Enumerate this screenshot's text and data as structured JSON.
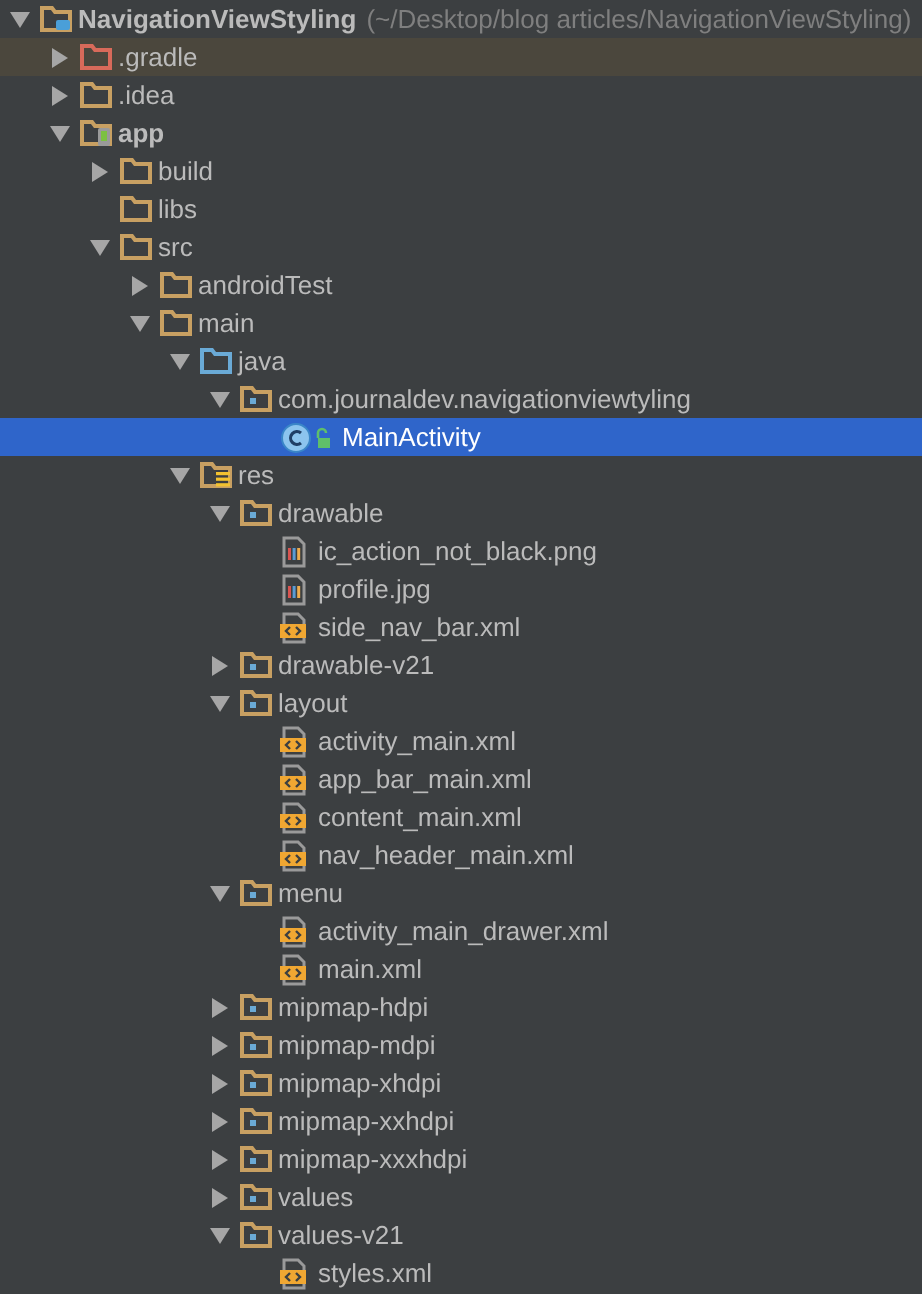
{
  "project": {
    "name": "NavigationViewStyling",
    "location": "(~/Desktop/blog articles/NavigationViewStyling)",
    "kind": "project",
    "expanded": true,
    "selected": false,
    "children": [
      {
        "name": ".gradle",
        "kind": "folder_excluded",
        "expanded": false,
        "selected": false,
        "excluded": true
      },
      {
        "name": ".idea",
        "kind": "folder",
        "expanded": false,
        "selected": false,
        "excluded": false
      },
      {
        "name": "app",
        "kind": "module",
        "expanded": true,
        "selected": false,
        "excluded": false,
        "children": [
          {
            "name": "build",
            "kind": "folder",
            "expanded": false,
            "selected": false
          },
          {
            "name": "libs",
            "kind": "folder",
            "selected": false
          },
          {
            "name": "src",
            "kind": "folder",
            "expanded": true,
            "selected": false,
            "children": [
              {
                "name": "androidTest",
                "kind": "folder",
                "expanded": false,
                "selected": false
              },
              {
                "name": "main",
                "kind": "folder",
                "expanded": true,
                "selected": false,
                "children": [
                  {
                    "name": "java",
                    "kind": "source",
                    "expanded": true,
                    "selected": false,
                    "children": [
                      {
                        "name": "com.journaldev.navigationviewtyling",
                        "kind": "package",
                        "expanded": true,
                        "selected": false,
                        "children": [
                          {
                            "name": "MainActivity",
                            "kind": "class",
                            "selected": true
                          }
                        ]
                      }
                    ]
                  },
                  {
                    "name": "res",
                    "kind": "res",
                    "expanded": true,
                    "selected": false,
                    "children": [
                      {
                        "name": "drawable",
                        "kind": "package",
                        "expanded": true,
                        "selected": false,
                        "children": [
                          {
                            "name": "ic_action_not_black.png",
                            "kind": "image",
                            "selected": false
                          },
                          {
                            "name": "profile.jpg",
                            "kind": "image",
                            "selected": false
                          },
                          {
                            "name": "side_nav_bar.xml",
                            "kind": "xml",
                            "selected": false
                          }
                        ]
                      },
                      {
                        "name": "drawable-v21",
                        "kind": "package",
                        "expanded": false,
                        "selected": false
                      },
                      {
                        "name": "layout",
                        "kind": "package",
                        "expanded": true,
                        "selected": false,
                        "children": [
                          {
                            "name": "activity_main.xml",
                            "kind": "xml",
                            "selected": false
                          },
                          {
                            "name": "app_bar_main.xml",
                            "kind": "xml",
                            "selected": false
                          },
                          {
                            "name": "content_main.xml",
                            "kind": "xml",
                            "selected": false
                          },
                          {
                            "name": "nav_header_main.xml",
                            "kind": "xml",
                            "selected": false
                          }
                        ]
                      },
                      {
                        "name": "menu",
                        "kind": "package",
                        "expanded": true,
                        "selected": false,
                        "children": [
                          {
                            "name": "activity_main_drawer.xml",
                            "kind": "xml",
                            "selected": false
                          },
                          {
                            "name": "main.xml",
                            "kind": "xml",
                            "selected": false
                          }
                        ]
                      },
                      {
                        "name": "mipmap-hdpi",
                        "kind": "package",
                        "expanded": false,
                        "selected": false
                      },
                      {
                        "name": "mipmap-mdpi",
                        "kind": "package",
                        "expanded": false,
                        "selected": false
                      },
                      {
                        "name": "mipmap-xhdpi",
                        "kind": "package",
                        "expanded": false,
                        "selected": false
                      },
                      {
                        "name": "mipmap-xxhdpi",
                        "kind": "package",
                        "expanded": false,
                        "selected": false
                      },
                      {
                        "name": "mipmap-xxxhdpi",
                        "kind": "package",
                        "expanded": false,
                        "selected": false
                      },
                      {
                        "name": "values",
                        "kind": "package",
                        "expanded": false,
                        "selected": false
                      },
                      {
                        "name": "values-v21",
                        "kind": "package",
                        "expanded": true,
                        "selected": false,
                        "children": [
                          {
                            "name": "styles.xml",
                            "kind": "xml",
                            "selected": false
                          }
                        ]
                      }
                    ]
                  }
                ]
              }
            ]
          }
        ]
      }
    ]
  }
}
